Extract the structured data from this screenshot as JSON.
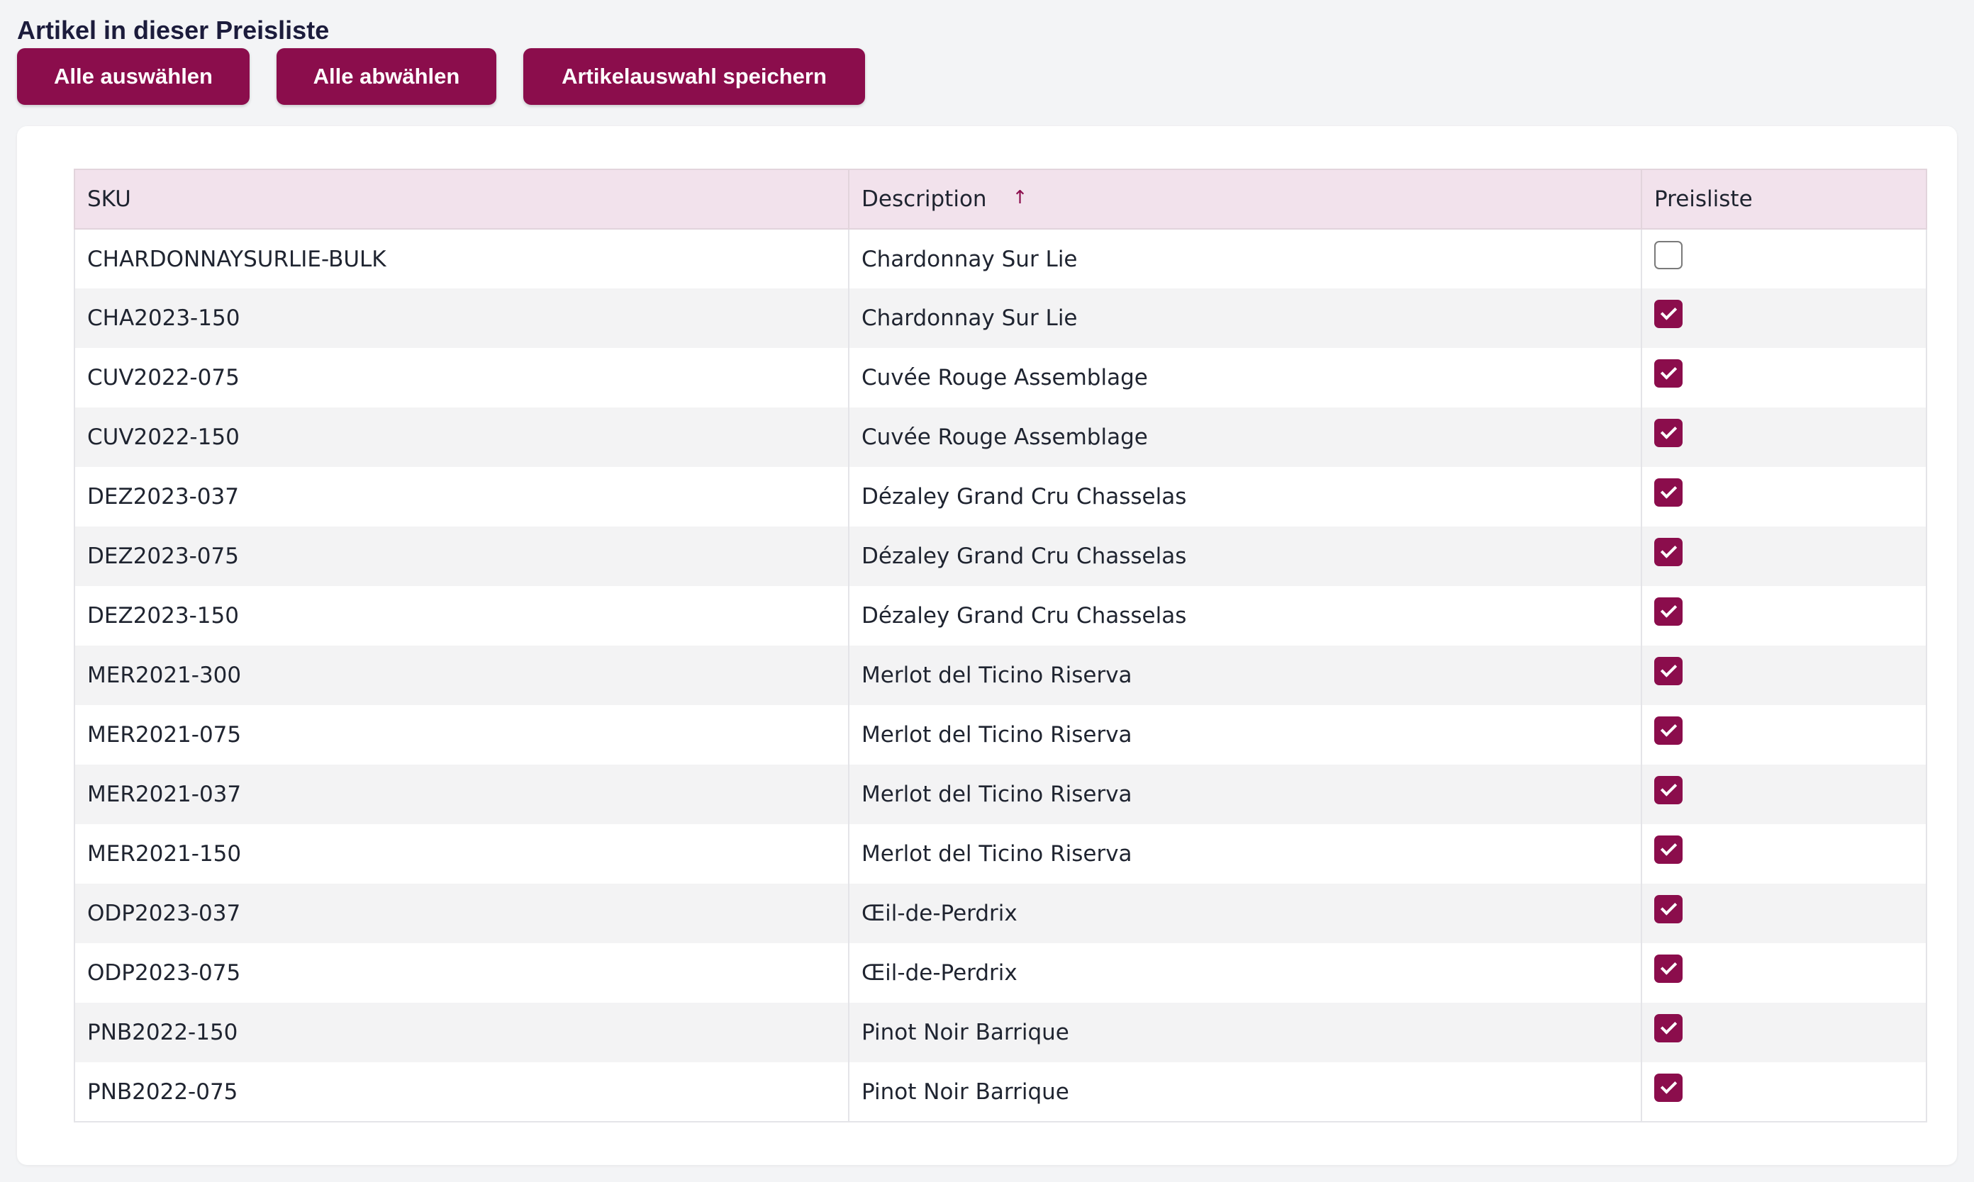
{
  "section": {
    "title": "Artikel in dieser Preisliste"
  },
  "toolbar": {
    "select_all_label": "Alle auswählen",
    "deselect_all_label": "Alle abwählen",
    "save_label": "Artikelauswahl speichern"
  },
  "colors": {
    "accent": "#8b0d4c",
    "header_bg": "#f2e2ec",
    "page_bg": "#f3f4f6"
  },
  "table": {
    "headers": {
      "sku": "SKU",
      "description": "Description",
      "description_sort_icon": "↑",
      "pricelist": "Preisliste"
    },
    "sort": {
      "column": "description",
      "direction": "ascending",
      "icon": "arrow-up-icon"
    },
    "rows": [
      {
        "sku": "CHARDONNAYSURLIE-BULK",
        "description": "Chardonnay Sur Lie",
        "in_pricelist": false
      },
      {
        "sku": "CHA2023-150",
        "description": "Chardonnay Sur Lie",
        "in_pricelist": true
      },
      {
        "sku": "CUV2022-075",
        "description": "Cuvée Rouge Assemblage",
        "in_pricelist": true
      },
      {
        "sku": "CUV2022-150",
        "description": "Cuvée Rouge Assemblage",
        "in_pricelist": true
      },
      {
        "sku": "DEZ2023-037",
        "description": "Dézaley Grand Cru Chasselas",
        "in_pricelist": true
      },
      {
        "sku": "DEZ2023-075",
        "description": "Dézaley Grand Cru Chasselas",
        "in_pricelist": true
      },
      {
        "sku": "DEZ2023-150",
        "description": "Dézaley Grand Cru Chasselas",
        "in_pricelist": true
      },
      {
        "sku": "MER2021-300",
        "description": "Merlot del Ticino Riserva",
        "in_pricelist": true
      },
      {
        "sku": "MER2021-075",
        "description": "Merlot del Ticino Riserva",
        "in_pricelist": true
      },
      {
        "sku": "MER2021-037",
        "description": "Merlot del Ticino Riserva",
        "in_pricelist": true
      },
      {
        "sku": "MER2021-150",
        "description": "Merlot del Ticino Riserva",
        "in_pricelist": true
      },
      {
        "sku": "ODP2023-037",
        "description": "Œil-de-Perdrix",
        "in_pricelist": true
      },
      {
        "sku": "ODP2023-075",
        "description": "Œil-de-Perdrix",
        "in_pricelist": true
      },
      {
        "sku": "PNB2022-150",
        "description": "Pinot Noir Barrique",
        "in_pricelist": true
      },
      {
        "sku": "PNB2022-075",
        "description": "Pinot Noir Barrique",
        "in_pricelist": true
      }
    ]
  }
}
